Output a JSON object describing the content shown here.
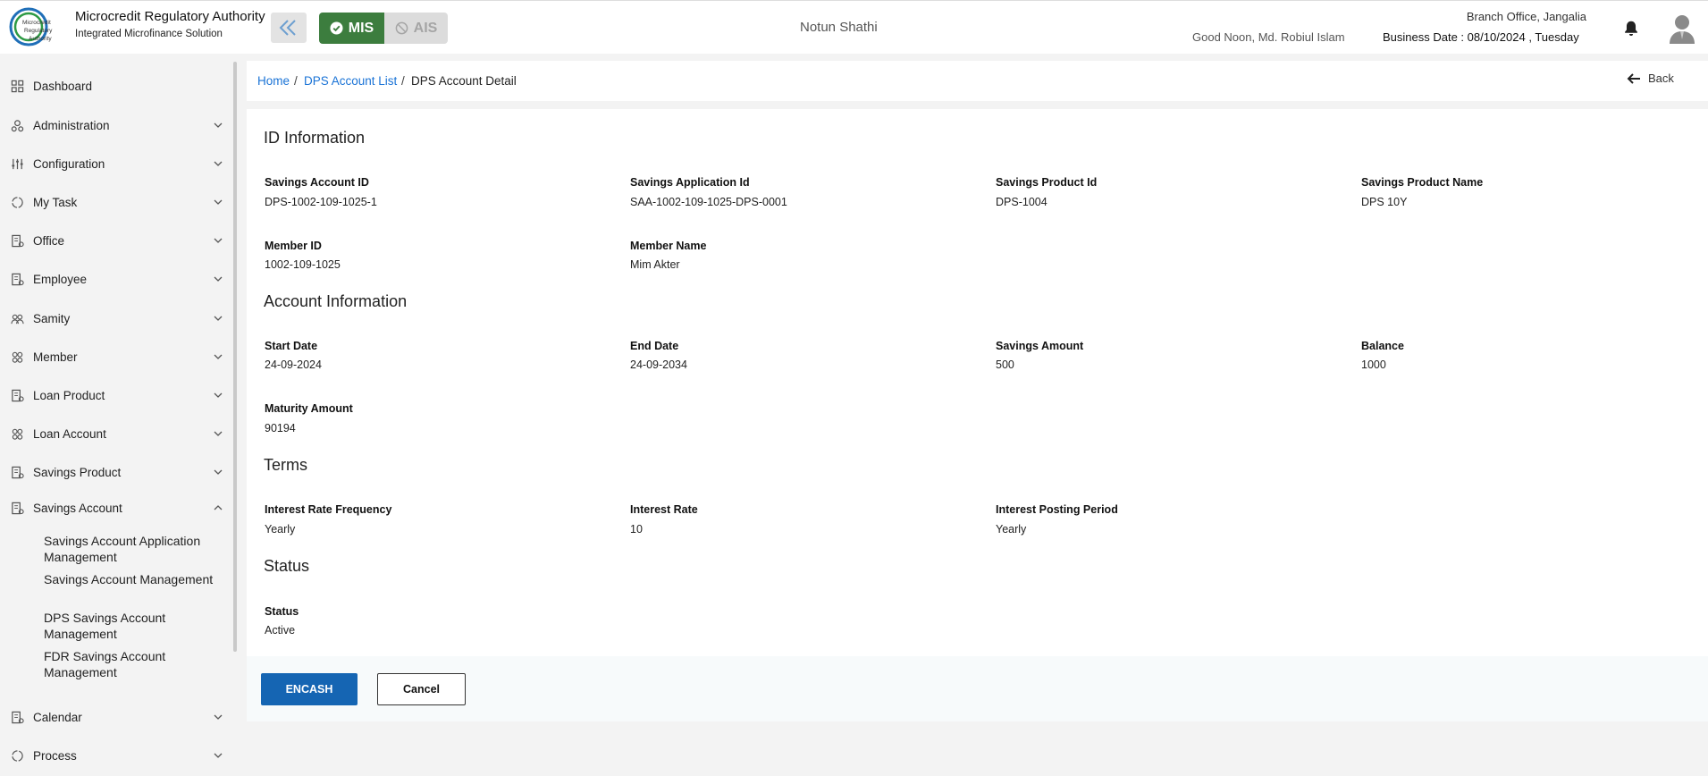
{
  "header": {
    "org_name": "Microcredit Regulatory Authority",
    "org_subtitle": "Integrated Microfinance Solution",
    "logo_text": "Microcredit Regulatory Authority",
    "mode_mis": "MIS",
    "mode_ais": "AIS",
    "center_title": "Notun Shathi",
    "greeting": "Good Noon, Md. Robiul Islam",
    "branch": "Branch Office, Jangalia",
    "business_date": "Business Date : 08/10/2024 , Tuesday",
    "colors": {
      "mis_active": "#3c7d3e",
      "primary": "#1565b3",
      "link": "#1a73d6"
    }
  },
  "sidebar": {
    "items": [
      {
        "label": "Dashboard",
        "icon": "dashboard-icon"
      },
      {
        "label": "Administration",
        "icon": "administration-icon"
      },
      {
        "label": "Configuration",
        "icon": "sliders-icon"
      },
      {
        "label": "My Task",
        "icon": "task-icon"
      },
      {
        "label": "Office",
        "icon": "office-icon"
      },
      {
        "label": "Employee",
        "icon": "employee-icon"
      },
      {
        "label": "Samity",
        "icon": "samity-icon"
      },
      {
        "label": "Member",
        "icon": "member-icon"
      },
      {
        "label": "Loan Product",
        "icon": "loan-product-icon"
      },
      {
        "label": "Loan Account",
        "icon": "loan-account-icon"
      },
      {
        "label": "Savings Product",
        "icon": "savings-product-icon"
      },
      {
        "label": "Savings Account",
        "icon": "savings-account-icon"
      },
      {
        "label": "Calendar",
        "icon": "calendar-icon"
      },
      {
        "label": "Process",
        "icon": "process-icon"
      }
    ],
    "savings_account_children": [
      "Savings Account Application Management",
      "Savings Account Management",
      "DPS Savings Account Management",
      "FDR Savings Account Management"
    ]
  },
  "breadcrumb": {
    "home": "Home",
    "list": "DPS Account List",
    "current": "DPS Account Detail",
    "sep": "/"
  },
  "back_label": "Back",
  "sections": {
    "id_info": {
      "title": "ID Information",
      "fields": [
        {
          "label": "Savings Account ID",
          "value": "DPS-1002-109-1025-1"
        },
        {
          "label": "Savings Application Id",
          "value": "SAA-1002-109-1025-DPS-0001"
        },
        {
          "label": "Savings Product Id",
          "value": "DPS-1004"
        },
        {
          "label": "Savings Product Name",
          "value": "DPS 10Y"
        },
        {
          "label": "Member ID",
          "value": "1002-109-1025"
        },
        {
          "label": "Member Name",
          "value": "Mim Akter"
        }
      ]
    },
    "account_info": {
      "title": "Account Information",
      "fields": [
        {
          "label": "Start Date",
          "value": "24-09-2024"
        },
        {
          "label": "End Date",
          "value": "24-09-2034"
        },
        {
          "label": "Savings Amount",
          "value": "500"
        },
        {
          "label": "Balance",
          "value": "1000"
        },
        {
          "label": "Maturity Amount",
          "value": "90194"
        }
      ]
    },
    "terms": {
      "title": "Terms",
      "fields": [
        {
          "label": "Interest Rate Frequency",
          "value": "Yearly"
        },
        {
          "label": "Interest Rate",
          "value": "10"
        },
        {
          "label": "Interest Posting Period",
          "value": "Yearly"
        }
      ]
    },
    "status": {
      "title": "Status",
      "fields": [
        {
          "label": "Status",
          "value": "Active"
        }
      ]
    }
  },
  "actions": {
    "encash": "ENCASH",
    "cancel": "Cancel"
  }
}
